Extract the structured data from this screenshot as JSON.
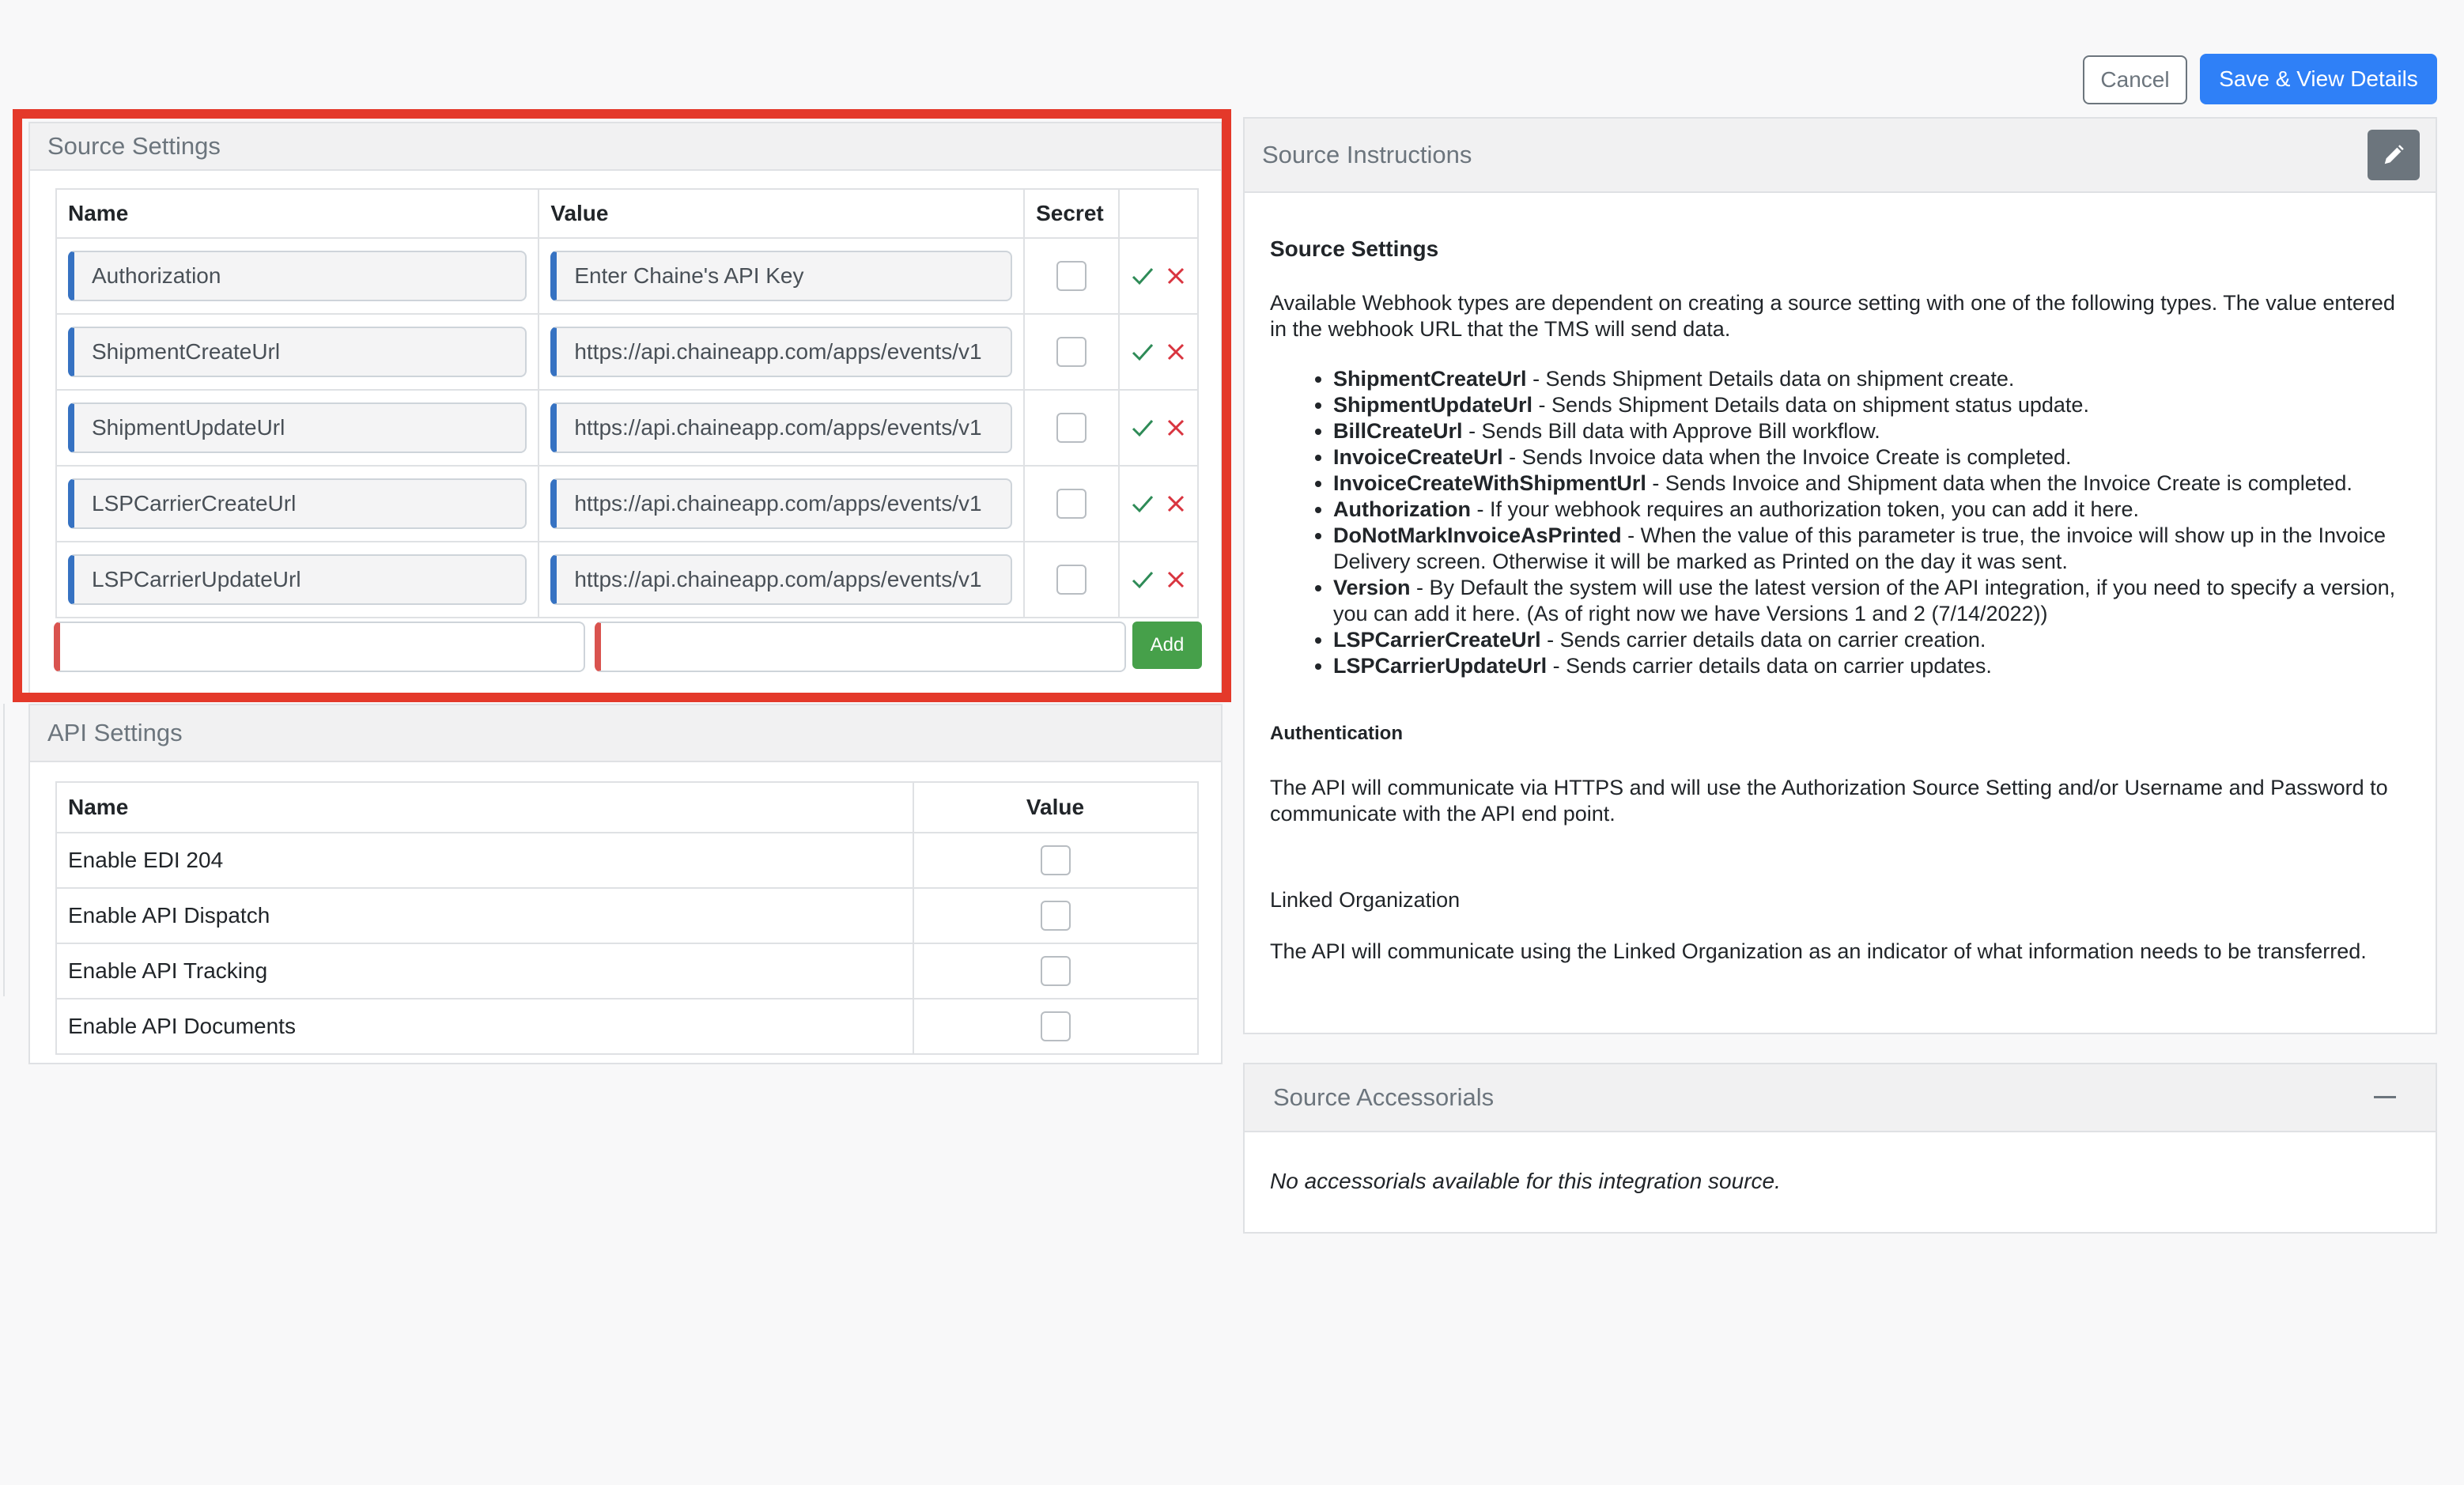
{
  "toolbar": {
    "cancel_label": "Cancel",
    "save_label": "Save & View Details"
  },
  "source_settings": {
    "title": "Source Settings",
    "columns": {
      "name": "Name",
      "value": "Value",
      "secret": "Secret"
    },
    "rows": [
      {
        "name": "Authorization",
        "value": "Enter Chaine's API Key"
      },
      {
        "name": "ShipmentCreateUrl",
        "value": "https://api.chaineapp.com/apps/events/v1"
      },
      {
        "name": "ShipmentUpdateUrl",
        "value": "https://api.chaineapp.com/apps/events/v1"
      },
      {
        "name": "LSPCarrierCreateUrl",
        "value": "https://api.chaineapp.com/apps/events/v1"
      },
      {
        "name": "LSPCarrierUpdateUrl",
        "value": "https://api.chaineapp.com/apps/events/v1"
      }
    ],
    "add_label": "Add",
    "colors": {
      "highlight": "#e4392a",
      "field_accent": "#3672c2",
      "new_field_accent": "#d9534f",
      "confirm": "#2e8b57",
      "delete": "#d9343f"
    }
  },
  "api_settings": {
    "title": "API Settings",
    "columns": {
      "name": "Name",
      "value": "Value"
    },
    "rows": [
      {
        "name": "Enable EDI 204"
      },
      {
        "name": "Enable API Dispatch"
      },
      {
        "name": "Enable API Tracking"
      },
      {
        "name": "Enable API Documents"
      }
    ]
  },
  "instructions": {
    "title": "Source Instructions",
    "heading": "Source Settings",
    "intro": "Available Webhook types are dependent on creating a source setting with one of the following types. The value entered in the webhook URL that the TMS will send data.",
    "items": [
      {
        "term": "ShipmentCreateUrl",
        "desc": " - Sends Shipment Details data on shipment create."
      },
      {
        "term": "ShipmentUpdateUrl",
        "desc": " - Sends Shipment Details data on shipment status update."
      },
      {
        "term": "BillCreateUrl",
        "desc": " - Sends Bill data with Approve Bill workflow."
      },
      {
        "term": "InvoiceCreateUrl",
        "desc": " - Sends Invoice data when the Invoice Create is completed."
      },
      {
        "term": "InvoiceCreateWithShipmentUrl",
        "desc": " - Sends Invoice and Shipment data when the Invoice Create is completed."
      },
      {
        "term": "Authorization",
        "desc": " - If your webhook requires an authorization token, you can add it here."
      },
      {
        "term": "DoNotMarkInvoiceAsPrinted",
        "desc": " - When the value of this parameter is true, the invoice will show up in the Invoice Delivery screen. Otherwise it will be marked as Printed on the day it was sent."
      },
      {
        "term": "Version",
        "desc": " - By Default the system will use the latest version of the API integration, if you need to specify a version, you can add it here. (As of right now we have Versions 1 and 2 (7/14/2022))"
      },
      {
        "term": "LSPCarrierCreateUrl",
        "desc": " - Sends carrier details data on carrier creation."
      },
      {
        "term": "LSPCarrierUpdateUrl",
        "desc": " - Sends carrier details data on carrier updates."
      }
    ],
    "auth_heading": "Authentication",
    "auth_text": "The API will communicate via HTTPS and will use the Authorization Source Setting and/or Username and Password to communicate with the API end point.",
    "linked_heading": "Linked Organization",
    "linked_text": "The API will communicate using the Linked Organization as an indicator of what information needs to be transferred."
  },
  "accessorials": {
    "title": "Source Accessorials",
    "empty_text": "No accessorials available for this integration source."
  }
}
